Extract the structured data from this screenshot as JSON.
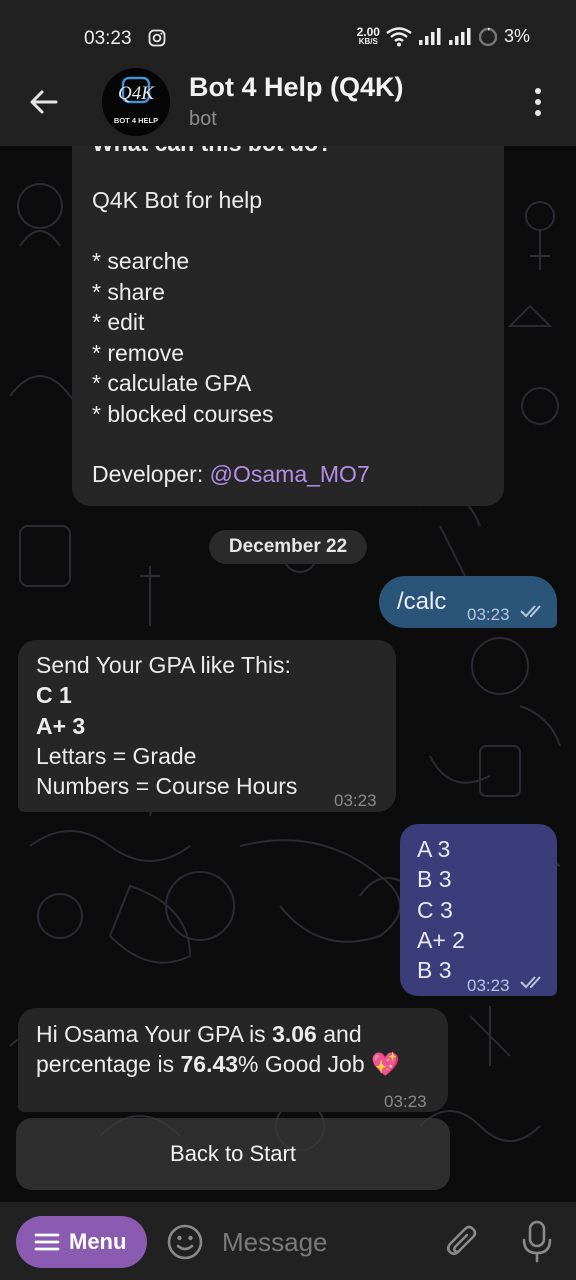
{
  "status_bar": {
    "time": "03:23",
    "speed_value": "2.00",
    "speed_unit": "KB/S",
    "battery": "3%",
    "icons": [
      "instagram-icon",
      "wifi-icon",
      "signal-icon",
      "signal-icon",
      "battery-icon"
    ]
  },
  "app_bar": {
    "title": "Bot 4 Help (Q4K)",
    "subtitle": "bot",
    "avatar_logo": "Q4K",
    "avatar_caption": "BOT 4 HELP"
  },
  "intro": {
    "heading_cut": "What can this bot do?",
    "line1": "Q4K Bot for help",
    "features": [
      "* searche",
      "* share",
      "* edit",
      "* remove",
      "* calculate GPA",
      "* blocked courses"
    ],
    "developer_label": "Developer: ",
    "developer_link": "@Osama_MO7"
  },
  "date_chip": "December 22",
  "messages": {
    "calc": {
      "text": "/calc",
      "time": "03:23"
    },
    "instructions": {
      "line1": "Send Your GPA like This:",
      "ex1": "C 1",
      "ex2": "A+ 3",
      "line4": "Lettars = Grade",
      "line5": "Numbers = Course Hours",
      "time": "03:23"
    },
    "grades": {
      "lines": [
        "A 3",
        "B 3",
        "C 3",
        "A+ 2",
        "B 3"
      ],
      "time": "03:23"
    },
    "result": {
      "p1": "Hi Osama Your GPA is ",
      "gpa": "3.06",
      "p2": " and",
      "p3": "percentage is ",
      "percent": "76.43",
      "p4": "% Good Job ",
      "emoji": "💖",
      "time": "03:23"
    }
  },
  "keyboard_button": "Back to Start",
  "input_bar": {
    "menu_label": "Menu",
    "placeholder": "Message"
  },
  "colors": {
    "header_bg": "#212121",
    "incoming_bubble": "#262626",
    "outgoing_blue": "#2a5578",
    "outgoing_purple": "#3a3d79",
    "link": "#b48ee6",
    "menu_button": "#8a5bb0"
  }
}
